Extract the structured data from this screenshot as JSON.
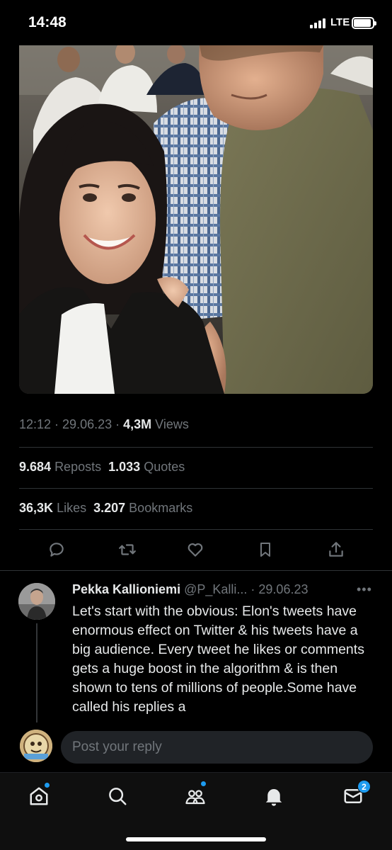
{
  "status_bar": {
    "time": "14:48",
    "network": "LTE"
  },
  "tweet": {
    "time": "12:12",
    "date": "29.06.23",
    "views_count": "4,3M",
    "views_label": "Views",
    "reposts_count": "9.684",
    "reposts_label": "Reposts",
    "quotes_count": "1.033",
    "quotes_label": "Quotes",
    "likes_count": "36,3K",
    "likes_label": "Likes",
    "bookmarks_count": "3.207",
    "bookmarks_label": "Bookmarks"
  },
  "reply": {
    "name": "Pekka Kallioniemi",
    "handle": "@P_Kalli...",
    "date": "29.06.23",
    "text": "Let's start with the obvious: Elon's tweets have enormous effect on Twitter & his tweets have a big audience. Every tweet he likes or comments gets a huge boost in the algorithm & is then shown to tens of millions of people.Some have called his replies a"
  },
  "compose": {
    "placeholder": "Post your reply"
  },
  "tab_bar": {
    "messages_badge": "2"
  },
  "colors": {
    "accent": "#1d9bf0",
    "background": "#000000",
    "secondary_text": "#71767b"
  }
}
